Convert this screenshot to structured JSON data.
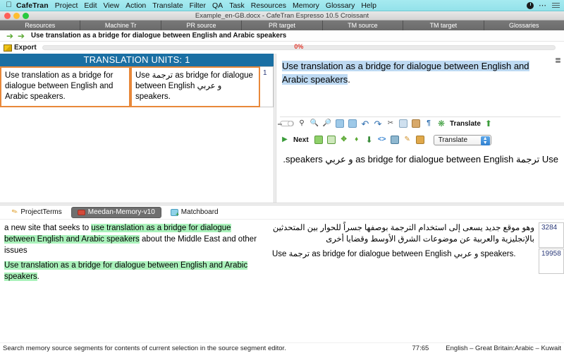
{
  "menubar": {
    "apple": "",
    "app_name": "CafeTran",
    "items": [
      "Project",
      "Edit",
      "View",
      "Action",
      "Translate",
      "Filter",
      "QA",
      "Task",
      "Resources",
      "Memory",
      "Glossary",
      "Help"
    ],
    "right_icons": [
      "clock-icon",
      "ellipsis-icon",
      "list-icon"
    ]
  },
  "window": {
    "title": "Example_en-GB.docx - CafeTran Espresso 10.5 Croissant"
  },
  "resource_tabs": [
    "Resources",
    "Machine Tr",
    "PR source",
    "PR target",
    "TM source",
    "TM target",
    "Glossaries"
  ],
  "segment_nav": {
    "prev_icon": "arrow-left-icon",
    "next_icon": "arrow-right-icon",
    "text": "Use translation as a bridge for dialogue between English and Arabic speakers"
  },
  "export": {
    "icon": "flag-icon",
    "label": "Export",
    "progress_pct": "0%",
    "progress_value": 0
  },
  "translation_units": {
    "header": "TRANSLATION UNITS: 1",
    "rows": [
      {
        "source": "Use translation as a bridge for dialogue between English and Arabic speakers.",
        "target": "Use ترجمة as bridge for dialogue between English و عربي speakers.",
        "number": "1"
      }
    ]
  },
  "source_editor": {
    "highlighted_text": "Use translation as a bridge for dialogue between English and Arabic speakers",
    "trailing_text": "."
  },
  "editor_toolbar_1": {
    "icons": [
      "toggle-switch",
      "find-icon",
      "zoom-in-icon",
      "zoom-out-icon",
      "spellcheck-icon",
      "spellcheck-all-icon",
      "undo-icon",
      "redo-icon",
      "cut-icon",
      "copy-icon",
      "paste-icon",
      "pilcrow-icon",
      "translate-icon"
    ],
    "translate_label": "Translate",
    "upload_icon": "arrow-up-icon"
  },
  "editor_toolbar_2": {
    "next_icon": "next-segment-icon",
    "next_label": "Next",
    "icons": [
      "insert-left-icon",
      "insert-right-icon",
      "join-icon",
      "split-icon",
      "down-icon",
      "tag-icon",
      "memory-icon",
      "edit-icon",
      "glossary-icon"
    ],
    "combo_value": "Translate",
    "combo_icon": "stepper-icon"
  },
  "target_editor": {
    "text": "Use ترجمة as bridge for dialogue between English و عربي speakers."
  },
  "bottom_tabs": [
    {
      "label": "ProjectTerms",
      "icon": "pencil-icon",
      "active": false
    },
    {
      "label": "Meedan-Memory-v10",
      "icon": "memory-icon",
      "active": true
    },
    {
      "label": "Matchboard",
      "icon": "matchboard-icon",
      "active": false
    }
  ],
  "results": [
    {
      "source_pre": "a new site that seeks to ",
      "source_hl": "use translation as a bridge for dialogue between English and Arabic speakers",
      "source_post": " about the Middle East and other issues",
      "target": "وهو موقع جديد يسعى إلى استخدام الترجمة بوصفها جسراً للحوار بين المتحدثين بالإنجليزية والعربية عن موضوعات الشرق الأوسط وقضايا أخرى",
      "id": "3284"
    },
    {
      "source_pre": "",
      "source_hl": "Use translation as a bridge for dialogue between English and Arabic speakers",
      "source_post": ".",
      "target": "Use ترجمة as bridge for dialogue between English و عربي speakers.",
      "id": "19958"
    }
  ],
  "statusbar": {
    "message": "Search memory source segments for contents of current selection in the source segment editor.",
    "position": "77:65",
    "languages": "English – Great Britain:Arabic – Kuwait"
  },
  "colors": {
    "menubar": "#9fe6ee",
    "tu_header": "#1a6fa3",
    "tu_border": "#e8883a",
    "highlight_blue": "#bdd9f2",
    "highlight_green": "#aaf2bb",
    "progress_text": "#e03a2f",
    "tab_active": "#6f6f6f"
  }
}
